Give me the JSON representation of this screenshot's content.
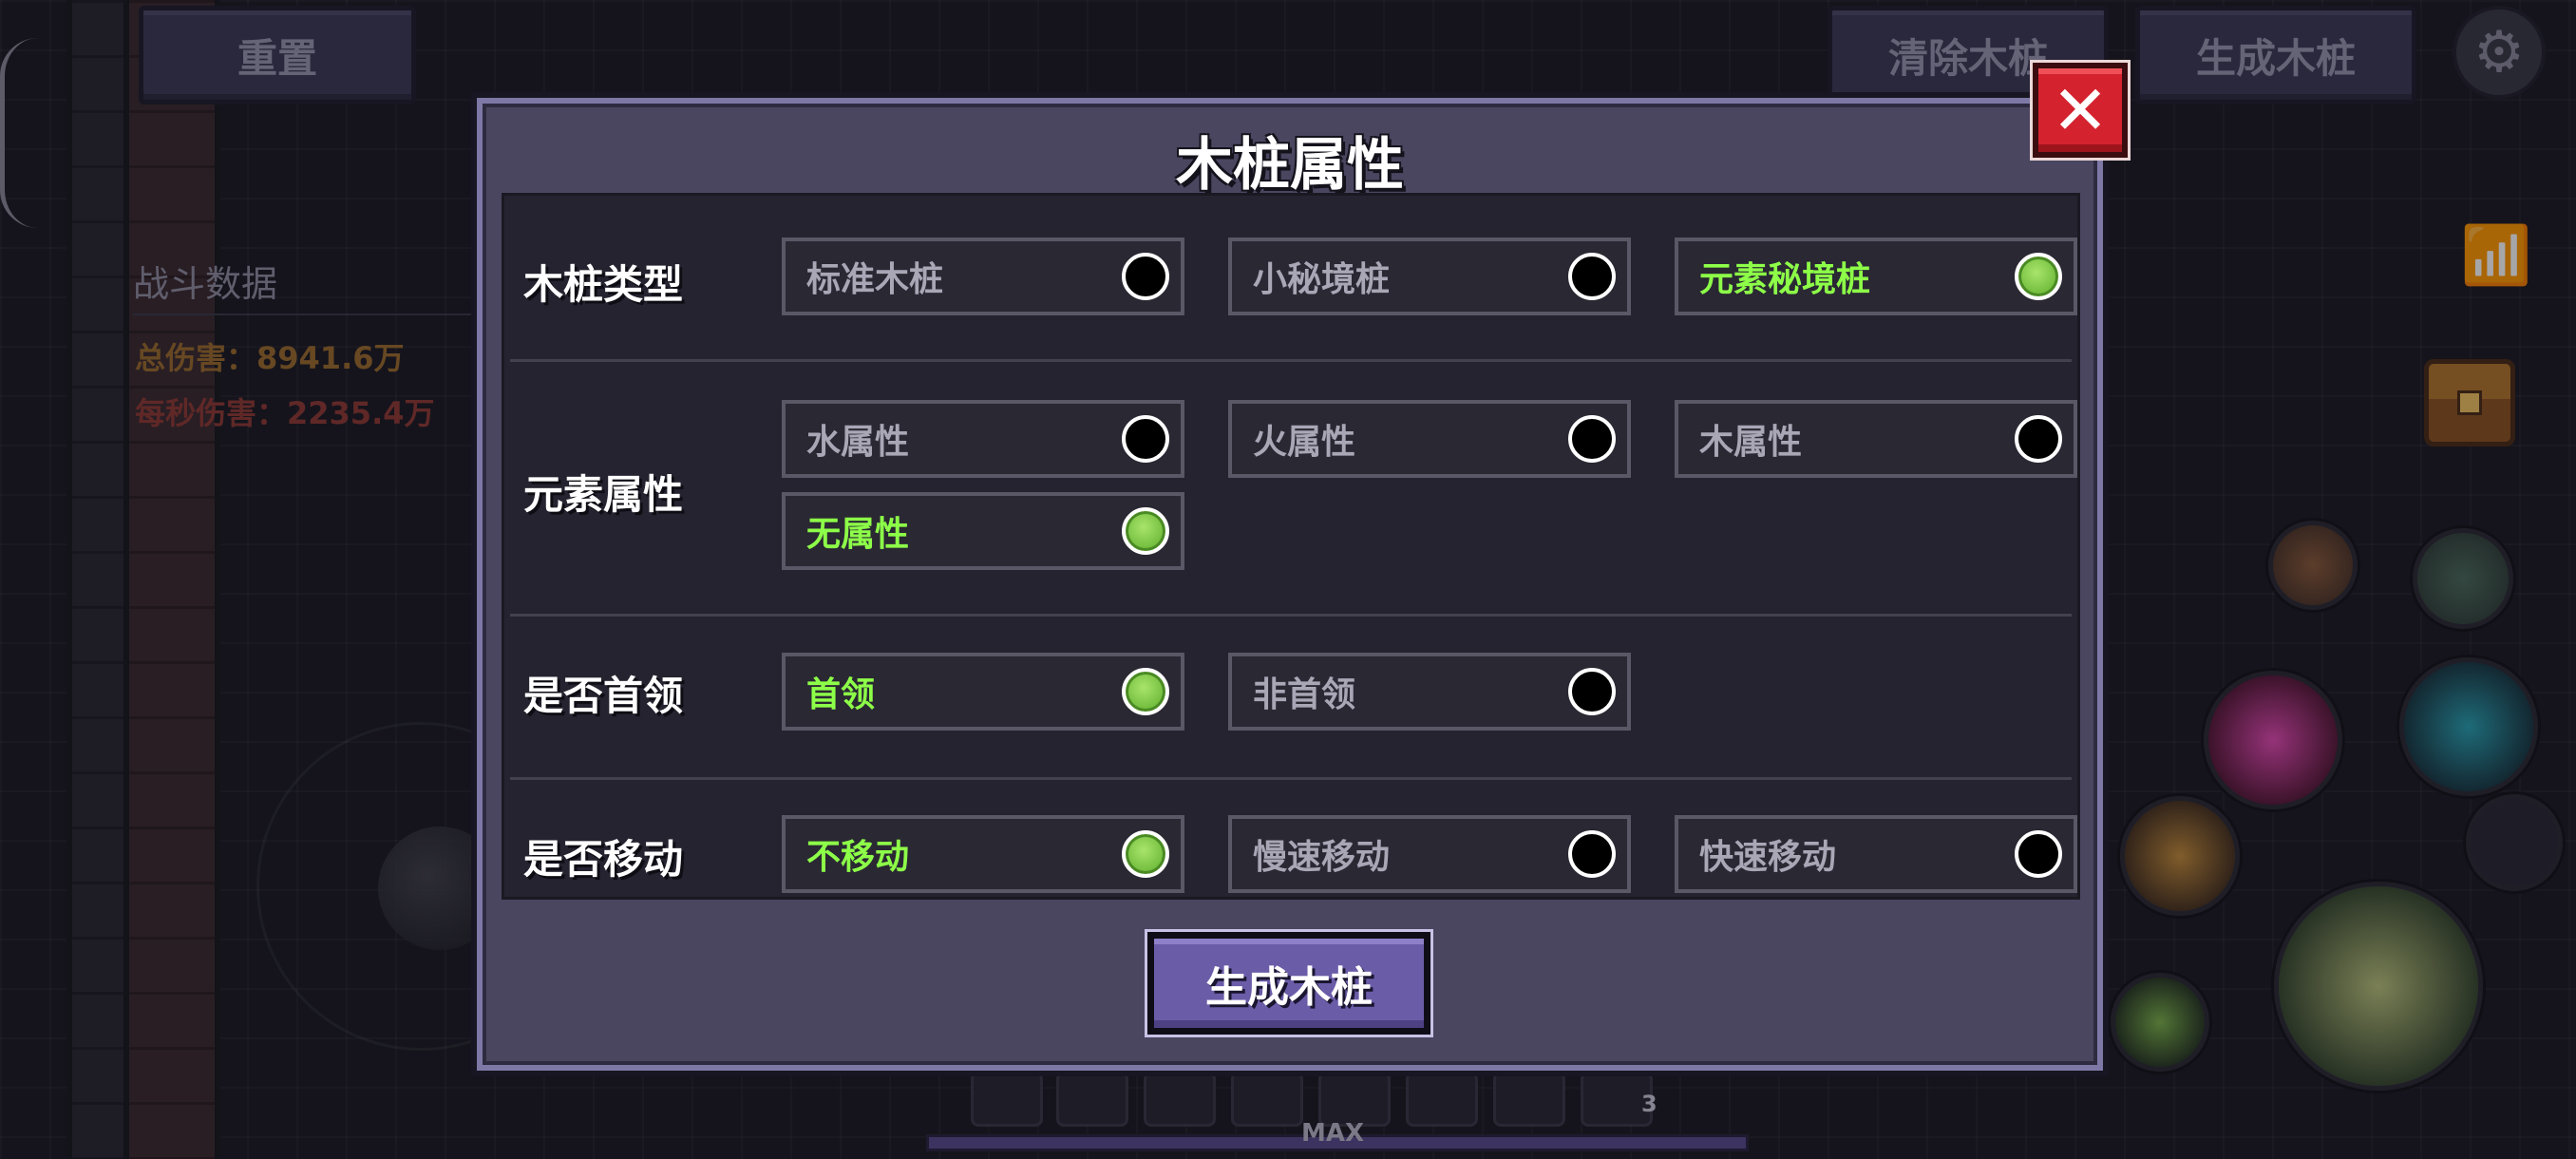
{
  "top_bar": {
    "reset_label": "重置",
    "clear_label": "清除木桩",
    "spawn_label": "生成木桩"
  },
  "battle": {
    "title": "战斗数据",
    "total_damage": "总伤害：8941.6万",
    "dps": "每秒伤害：2235.4万"
  },
  "hotbar": {
    "max_label": "MAX",
    "stack_count": "3"
  },
  "modal": {
    "title": "木桩属性",
    "close_glyph": "✕",
    "rows": [
      {
        "label": "木桩类型",
        "options": [
          {
            "label": "标准木桩",
            "selected": false
          },
          {
            "label": "小秘境桩",
            "selected": false
          },
          {
            "label": "元素秘境桩",
            "selected": true
          }
        ]
      },
      {
        "label": "元素属性",
        "options": [
          {
            "label": "水属性",
            "selected": false
          },
          {
            "label": "火属性",
            "selected": false
          },
          {
            "label": "木属性",
            "selected": false
          },
          {
            "label": "无属性",
            "selected": true
          }
        ]
      },
      {
        "label": "是否首领",
        "options": [
          {
            "label": "首领",
            "selected": true
          },
          {
            "label": "非首领",
            "selected": false
          }
        ]
      },
      {
        "label": "是否移动",
        "options": [
          {
            "label": "不移动",
            "selected": true
          },
          {
            "label": "慢速移动",
            "selected": false
          },
          {
            "label": "快速移动",
            "selected": false
          }
        ]
      }
    ],
    "generate_label": "生成木桩"
  },
  "icons": {
    "settings": "gear-icon",
    "stats": "chart-icon",
    "inventory": "chest-icon"
  },
  "colors": {
    "selected_text": "#8dff48",
    "selected_radio": "#6fbb3a",
    "close_button": "#d4232e",
    "generate_button": "#6b5ca8",
    "total_damage_text": "#9a6a2c",
    "dps_text": "#8e3a34"
  }
}
